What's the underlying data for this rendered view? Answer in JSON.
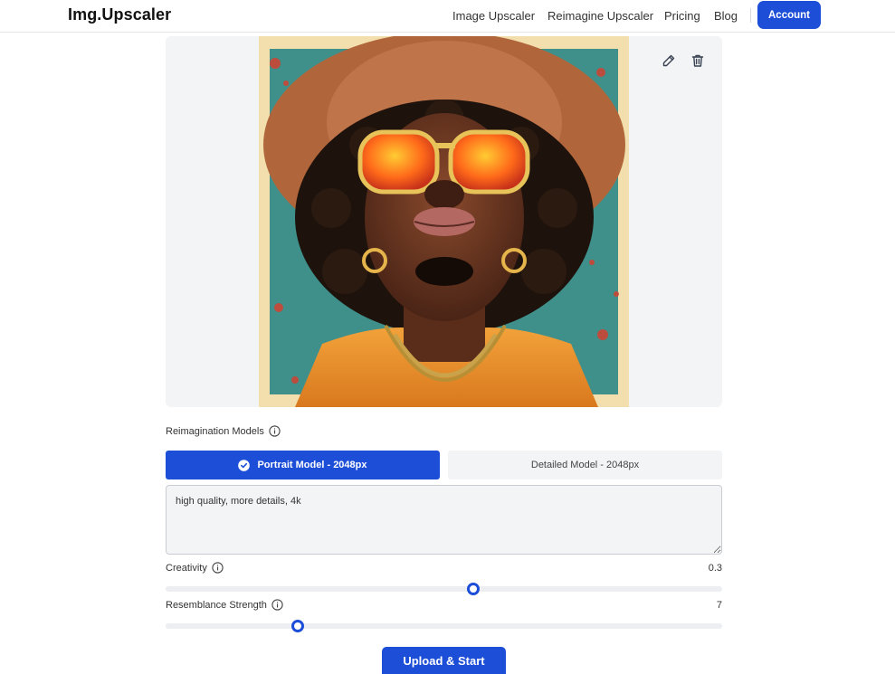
{
  "header": {
    "brand": "Img.Upscaler",
    "nav": [
      "Image Upscaler",
      "Reimagine Upscaler",
      "Pricing",
      "Blog"
    ],
    "account_label": "Account"
  },
  "image_panel": {
    "edit_icon": "pencil-icon",
    "delete_icon": "trash-icon"
  },
  "models": {
    "label": "Reimagination Models",
    "active": "Portrait Model - 2048px",
    "inactive": "Detailed Model - 2048px"
  },
  "prompt": {
    "value": "high quality, more details, 4k"
  },
  "creativity": {
    "label": "Creativity",
    "value": "0.3",
    "fraction": 0.553
  },
  "resemblance": {
    "label": "Resemblance Strength",
    "value": "7",
    "fraction": 0.237
  },
  "start_label": "Upload & Start",
  "colors": {
    "accent": "#1d4ed8"
  }
}
